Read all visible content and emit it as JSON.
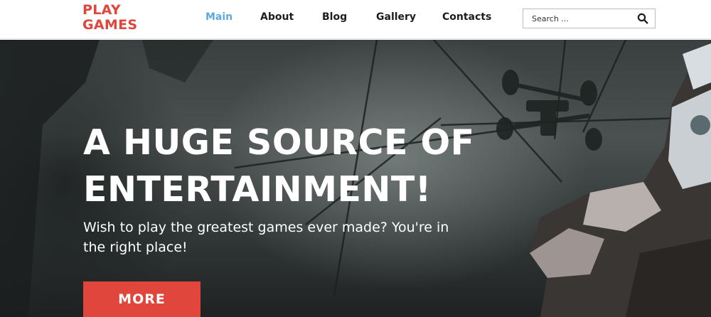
{
  "header": {
    "logo_line1": "PLAY",
    "logo_line2": "GAMES",
    "nav": [
      {
        "label": "Main",
        "active": true
      },
      {
        "label": "About",
        "active": false
      },
      {
        "label": "Blog",
        "active": false
      },
      {
        "label": "Gallery",
        "active": false
      },
      {
        "label": "Contacts",
        "active": false
      }
    ],
    "search": {
      "placeholder": "Search ...",
      "value": "",
      "icon": "search-icon"
    }
  },
  "hero": {
    "title_line1": "A HUGE SOURCE OF",
    "title_line2": "ENTERTAINMENT!",
    "subtitle": "Wish to play the greatest games ever made? You're in the right place!",
    "button_label": "MORE"
  },
  "colors": {
    "brand": "#e0463c",
    "nav_active": "#5ea9dd",
    "nav_text": "#1d1d1d"
  }
}
